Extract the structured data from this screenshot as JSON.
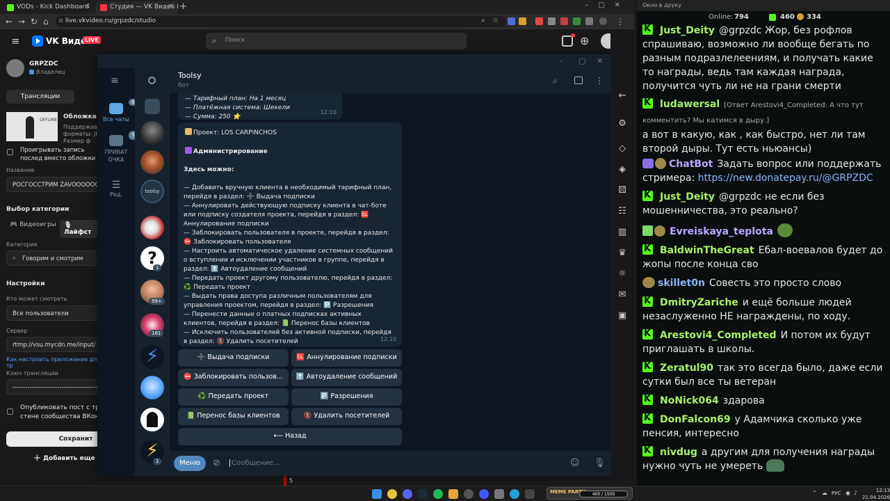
{
  "browser": {
    "tabs": [
      {
        "title": "VODs - Kick Dashboard"
      },
      {
        "title": "Студия — VK Видео Live"
      }
    ],
    "url": "live.vkvideo.ru/grpzdc/studio"
  },
  "vk": {
    "brand": "VK Видео",
    "live_badge": "LIVE",
    "search_placeholder": "Поиск",
    "channel_name": "GRPZDC",
    "channel_role": "Владелец",
    "broadcasts_tab": "Трансляции",
    "cover_title": "Обложка",
    "cover_hint": "Поддерживаемые форматы: JPG Размер ф более 10 Мб",
    "cover_thumb_text": "OFFLINE",
    "play_record_label": "Проигрывать запись послед вместо обложки",
    "name_label": "Название",
    "name_value": "РОСГОССТРИМ ZAVOOOOOOZ",
    "category_choice_label": "Выбор категории",
    "cat_games": "Видеоигры",
    "cat_lifestyle": "Лайфст",
    "category_label": "Категория",
    "category_value": "Говорим и смотрим",
    "settings_label": "Настройки",
    "who_can_watch_label": "Кто может смотреть",
    "who_can_watch_value": "Все пользователи",
    "server_label": "Сервер",
    "server_value": "rtmp://vsu.mycdn.me/input/",
    "setup_link": "Как настроить приложение для тр",
    "key_label": "Ключ трансляции",
    "key_value": "-------------------------------------------",
    "publish_label": "Опубликовать пост с тра стене сообщества ВКонт",
    "save_button": "Сохранит",
    "add_more": "Добавить еще",
    "cursor_num": "5"
  },
  "telegram": {
    "folders": [
      {
        "label": "Все чаты",
        "badge": "6"
      },
      {
        "label": "ПРИВАТ ОЧКА",
        "badge": "5"
      },
      {
        "label": "Ред.",
        "badge": ""
      }
    ],
    "chat_badges": [
      "1",
      "99+",
      "181",
      "1"
    ],
    "chat_title": "Toolsy",
    "chat_subtitle": "бот",
    "msg1": {
      "lines": [
        "— Тарифный план: На 1 месяц",
        "— Платёжная система: Шекели",
        "— Сумма: 250 ⭐"
      ],
      "time": "12:10"
    },
    "msg2": {
      "project": "Проект: LOS CARPINCHOS",
      "admin": "Администрирование",
      "here": "Здесь можно:",
      "lines": [
        "— Добавить вручную клиента в необходимый тарифный план, перейдя в раздел: ➕ Выдача подписки",
        "— Аннулировать действующую подписку клиента в чат-боте или подписку создателя проекта, перейдя в раздел: 🆑 Аннулирование подписки",
        "— Заблокировать пользователя в проекте, перейдя в раздел: ⛔ Заблокировать пользователя",
        "— Настроить автоматическое удаление системных сообщений о вступлении и исключении участников в группе, перейдя в раздел: ⬆️ Автоудаление сообщений",
        "— Передать проект другому пользователю, перейдя в раздел: ♻️ Передать проект",
        "— Выдать права доступа различным пользователям для управления проектом, перейдя в раздел: 🅿️ Разрешения",
        "— Перенести данные о платных подписках активных клиентов, перейдя в раздел: 📗 Перенос базы клиентов",
        "— Исключить пользователей без активной подписки, перейдя в раздел: 🚷 Удалить посетителей"
      ],
      "time": "12:10"
    },
    "keyboard": [
      [
        "➕ Выдача подписки",
        "🆑 Аннулирование подписки"
      ],
      [
        "⛔ Заблокировать пользов...",
        "⬆️ Автоудаление сообщений"
      ],
      [
        "♻️ Передать проект",
        "🅿️ Разрешения"
      ],
      [
        "📗 Перенос базы клиентов",
        "🚷 Удалить посетителей"
      ],
      [
        "⟵ Назад"
      ]
    ],
    "menu_button": "Меню",
    "input_placeholder": "Сообщение..."
  },
  "kick": {
    "window_title": "Окно в друку",
    "online_label": "Online:",
    "online_value": "794",
    "count_a": "460",
    "count_b": "334",
    "messages": [
      {
        "user": "Just_Deity",
        "color": "#a8f06a",
        "text": "@grpzdc Жор, без рофлов спрашиваю, возможно ли вообще бегать по разным подразлелеениям, и получать какие то награды, ведь там каждая награда, получится чуть ли не на грани смерти"
      },
      {
        "user": "ludawersal",
        "color": "#a8f06a",
        "reply": "[Ответ Arestovi4_Completed: А что тут комментить? Мы катимся в дыру.]",
        "text": "а вот в какую, как , как быстро, нет ли там второй дыры. Тут есть ньюансы)"
      },
      {
        "user": "ChatBot",
        "color": "#b9a7ff",
        "text": "Задать вопрос или поддержать стримера:",
        "link": "https://new.donatepay.ru/@GRPZDC"
      },
      {
        "user": "Just_Deity",
        "color": "#a8f06a",
        "text": "@grpzdc не если без мошенничества, это реально?"
      },
      {
        "user": "Evreiskaya_teplota",
        "color": "#b9a7ff",
        "text": ""
      },
      {
        "user": "BaldwinTheGreat",
        "color": "#a8f06a",
        "text": "Ебал-воевалов будет до жопы после конца сво"
      },
      {
        "user": "skillet0n",
        "color": "#8ab4f8",
        "text": "Совесть это просто слово"
      },
      {
        "user": "DmitryZariche",
        "color": "#a8f06a",
        "text": "и ещё больше людей незаслуженно НЕ награждены, по ходу."
      },
      {
        "user": "Arestovi4_Completed",
        "color": "#a8f06a",
        "text": "И потом их будут приглашать в школы."
      },
      {
        "user": "Zeratul90",
        "color": "#a8f06a",
        "text": "так это всегда было, даже если сутки был все ты ветеран"
      },
      {
        "user": "NoNick064",
        "color": "#a8f06a",
        "text": "здарова"
      },
      {
        "user": "DonFalcon69",
        "color": "#a8f06a",
        "text": "у Адамчика сколько уже пенсия, интересно"
      },
      {
        "user": "nivdug",
        "color": "#a8f06a",
        "text": "а другим для получения награды нужно чуть не умереть"
      }
    ]
  },
  "taskbar": {
    "media_label": "MEME PARTY",
    "media_progress": "400 / 1500",
    "lang": "РУС",
    "time": "12:13",
    "date": "21.04.2026"
  }
}
